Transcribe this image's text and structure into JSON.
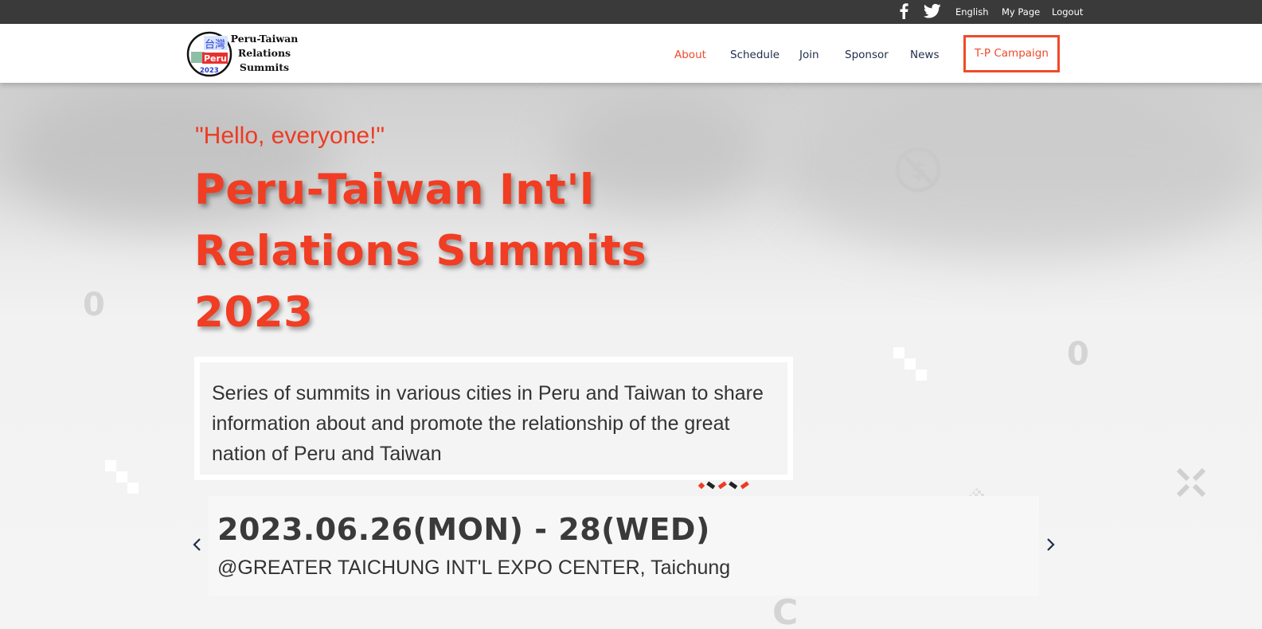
{
  "topbar": {
    "social": [
      "facebook-icon",
      "twitter-icon"
    ],
    "language": "English",
    "mypage": "My Page",
    "logout": "Logout"
  },
  "logo": {
    "line1": "Peru-Taiwan",
    "line2": "Relations",
    "line3": "Summits",
    "emblem_top": "台灣",
    "emblem_mid": "Peru",
    "emblem_year": "2023"
  },
  "nav": {
    "items": [
      "About",
      "Schedule",
      "Join",
      "Sponsor",
      "News"
    ],
    "active": "About",
    "campaign": "T-P Campaign"
  },
  "hero": {
    "greeting": "\"Hello, everyone!\"",
    "title_lines": [
      "Peru-Taiwan Int'l",
      "Relations Summits",
      "2023"
    ],
    "description": "Series of summits in various cities in Peru and Taiwan to share information about and promote the relationship of the great nation of Peru and Taiwan",
    "date": "2023.06.26(MON) - 28(WED)",
    "venue": "@GREATER TAICHUNG INT'L EXPO CENTER, Taichung"
  },
  "colors": {
    "accent": "#ef4a2a",
    "nav_text": "#1e2d4a",
    "topbar_bg": "#3a3a3a"
  }
}
